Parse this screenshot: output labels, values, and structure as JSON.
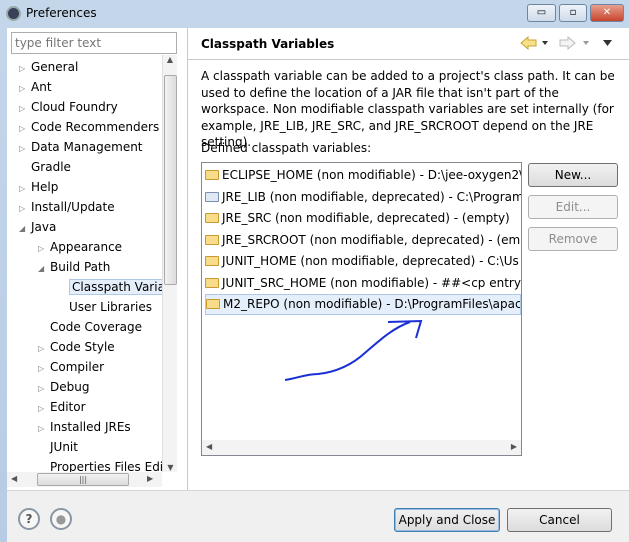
{
  "window": {
    "title": "Preferences",
    "minimize": "minimize",
    "maximize": "maximize",
    "close": "close"
  },
  "filter": {
    "placeholder": "type filter text"
  },
  "tree": [
    {
      "label": "General",
      "level": 0,
      "expander": "collapsed"
    },
    {
      "label": "Ant",
      "level": 0,
      "expander": "collapsed"
    },
    {
      "label": "Cloud Foundry",
      "level": 0,
      "expander": "collapsed"
    },
    {
      "label": "Code Recommenders",
      "level": 0,
      "expander": "collapsed"
    },
    {
      "label": "Data Management",
      "level": 0,
      "expander": "collapsed"
    },
    {
      "label": "Gradle",
      "level": 0,
      "expander": "none"
    },
    {
      "label": "Help",
      "level": 0,
      "expander": "collapsed"
    },
    {
      "label": "Install/Update",
      "level": 0,
      "expander": "collapsed"
    },
    {
      "label": "Java",
      "level": 0,
      "expander": "expanded"
    },
    {
      "label": "Appearance",
      "level": 1,
      "expander": "collapsed"
    },
    {
      "label": "Build Path",
      "level": 1,
      "expander": "expanded"
    },
    {
      "label": "Classpath Variables",
      "level": 2,
      "expander": "none",
      "selected": true
    },
    {
      "label": "User Libraries",
      "level": 2,
      "expander": "none"
    },
    {
      "label": "Code Coverage",
      "level": 1,
      "expander": "none"
    },
    {
      "label": "Code Style",
      "level": 1,
      "expander": "collapsed"
    },
    {
      "label": "Compiler",
      "level": 1,
      "expander": "collapsed"
    },
    {
      "label": "Debug",
      "level": 1,
      "expander": "collapsed"
    },
    {
      "label": "Editor",
      "level": 1,
      "expander": "collapsed"
    },
    {
      "label": "Installed JREs",
      "level": 1,
      "expander": "collapsed"
    },
    {
      "label": "JUnit",
      "level": 1,
      "expander": "none"
    },
    {
      "label": "Properties Files Editor",
      "level": 1,
      "expander": "none"
    }
  ],
  "page": {
    "title": "Classpath Variables",
    "description": "A classpath variable can be added to a project's class path. It can be used to define the location of a JAR file that isn't part of the workspace. Non modifiable classpath variables are set internally (for example, JRE_LIB, JRE_SRC, and JRE_SRCROOT depend on the JRE setting).",
    "list_label": "Defined classpath variables:",
    "variables": [
      {
        "text": "ECLIPSE_HOME (non modifiable) - D:\\jee-oxygen2\\",
        "icon": "folder-icon"
      },
      {
        "text": "JRE_LIB (non modifiable, deprecated) - C:\\Program",
        "icon": "jar-icon"
      },
      {
        "text": "JRE_SRC (non modifiable, deprecated) - (empty)",
        "icon": "folder-warning-icon"
      },
      {
        "text": "JRE_SRCROOT (non modifiable, deprecated) - (empty",
        "icon": "folder-warning-icon"
      },
      {
        "text": "JUNIT_HOME (non modifiable, deprecated) - C:\\Us",
        "icon": "folder-warning-icon"
      },
      {
        "text": "JUNIT_SRC_HOME (non modifiable) - ##<cp entry",
        "icon": "folder-icon"
      },
      {
        "text": "M2_REPO (non modifiable) - D:\\ProgramFiles\\apac",
        "icon": "folder-icon",
        "selected": true
      }
    ],
    "buttons": {
      "new": "New...",
      "edit": "Edit...",
      "remove": "Remove"
    }
  },
  "footer": {
    "apply_close": "Apply and Close",
    "cancel": "Cancel"
  },
  "colors": {
    "annotation": "#1a2fd6",
    "selection": "#e5eefb",
    "back_arrow": "#e8c34a"
  }
}
